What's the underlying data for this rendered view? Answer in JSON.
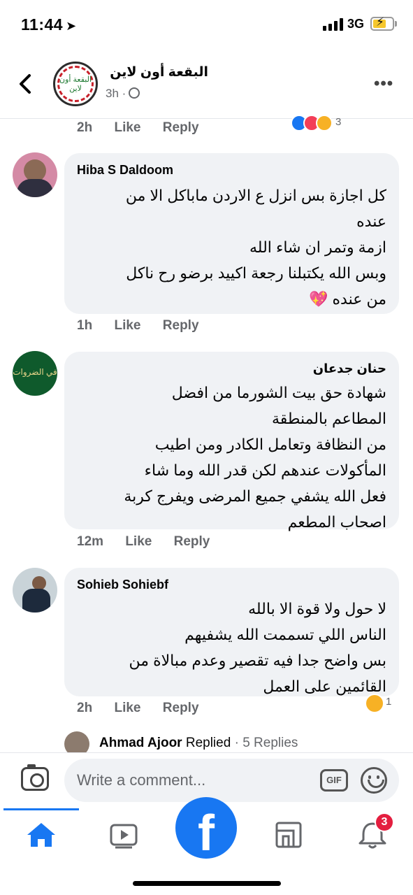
{
  "status_bar": {
    "time": "11:44",
    "location_icon": "location-arrow-icon",
    "network": "3G"
  },
  "header": {
    "page_name": "البقعة أون لاين",
    "logo_text": "البقعة أون لاين",
    "meta": "3h ·",
    "privacy_icon": "globe-icon",
    "more_label": "•••"
  },
  "top_comment": {
    "time": "2h",
    "like_label": "Like",
    "reply_label": "Reply",
    "reaction_icons": [
      "like-reaction-icon",
      "love-reaction-icon",
      "sad-reaction-icon"
    ],
    "reaction_count": "3"
  },
  "comments": [
    {
      "author": "Hiba S Daldoom",
      "lines": [
        "كل اجازة بس انزل ع الاردن ماباكل الا من",
        "عنده",
        "ازمة وتمر ان شاء الله",
        "وبس الله يكتبلنا رجعة اكييد برضو رح ناكل",
        "من عنده 💖"
      ],
      "time": "1h",
      "like_label": "Like",
      "reply_label": "Reply"
    },
    {
      "author": "حنان جدعان",
      "avatar_text": "في الضروات",
      "lines": [
        "شهادة حق  بيت الشورما من افضل",
        "المطاعم بالمنطقة",
        "من النظافة وتعامل الكادر  ومن اطيب",
        "المأكولات عندهم  لكن قدر الله وما شاء",
        "فعل الله يشفي جميع المرضى  ويفرج كربة",
        "اصحاب المطعم"
      ],
      "time": "12m",
      "like_label": "Like",
      "reply_label": "Reply"
    },
    {
      "author": "Sohieb Sohiebf",
      "lines": [
        "لا حول ولا قوة الا بالله",
        "الناس اللي تسممت الله يشفيهم",
        "بس واضح جدا فيه تقصير وعدم مبالاة من",
        "القائمين على العمل"
      ],
      "time": "2h",
      "like_label": "Like",
      "reply_label": "Reply",
      "reaction_icon": "sad-reaction-icon",
      "reaction_count": "1"
    }
  ],
  "replies": {
    "name": "Ahmad Ajoor",
    "verb": "Replied",
    "separator": "·",
    "count": "5 Replies"
  },
  "composer": {
    "placeholder": "Write a comment...",
    "gif_label": "GIF"
  },
  "tabbar": {
    "tabs": [
      "home-icon",
      "watch-icon",
      "facebook-logo-icon",
      "marketplace-icon",
      "notifications-icon"
    ],
    "fb_letter": "f",
    "notification_badge": "3",
    "active_color": "#1877f2"
  }
}
